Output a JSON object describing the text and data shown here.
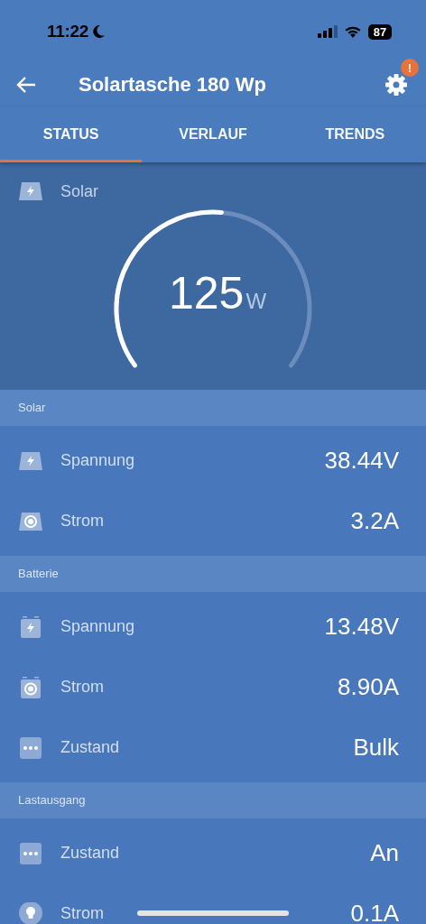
{
  "status_bar": {
    "time": "11:22",
    "battery": "87"
  },
  "header": {
    "title": "Solartasche 180 Wp",
    "alert_badge": "!"
  },
  "tabs": [
    {
      "label": "STATUS",
      "selected": true
    },
    {
      "label": "VERLAUF",
      "selected": false
    },
    {
      "label": "TRENDS",
      "selected": false
    }
  ],
  "gauge": {
    "label": "Solar",
    "value": "125",
    "unit": "W"
  },
  "sections": [
    {
      "title": "Solar",
      "rows": [
        {
          "kind": "panel-bolt",
          "label": "Spannung",
          "value": "38.44V"
        },
        {
          "kind": "panel-current",
          "label": "Strom",
          "value": "3.2A"
        }
      ]
    },
    {
      "title": "Batterie",
      "rows": [
        {
          "kind": "battery-bolt",
          "label": "Spannung",
          "value": "13.48V"
        },
        {
          "kind": "battery-current",
          "label": "Strom",
          "value": "8.90A"
        },
        {
          "kind": "dots",
          "label": "Zustand",
          "value": "Bulk"
        }
      ]
    },
    {
      "title": "Lastausgang",
      "rows": [
        {
          "kind": "dots",
          "label": "Zustand",
          "value": "An"
        },
        {
          "kind": "bulb",
          "label": "Strom",
          "value": "0.1A"
        }
      ]
    }
  ]
}
